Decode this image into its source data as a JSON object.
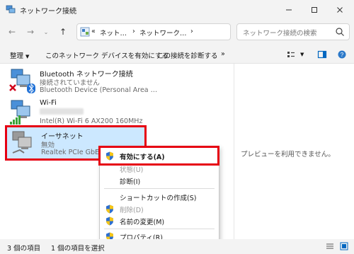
{
  "window": {
    "title": "ネットワーク接続"
  },
  "address": {
    "segments": [
      "«",
      "ネット…",
      "›",
      "ネットワーク…",
      "›"
    ]
  },
  "search": {
    "placeholder": "ネットワーク接続の検索"
  },
  "command_bar": {
    "organize": "整理",
    "enable_device": "このネットワーク デバイスを有効にする",
    "diagnose": "この接続を診断する",
    "more": "»"
  },
  "connections": [
    {
      "name": "Bluetooth ネットワーク接続",
      "status": "接続されていません",
      "device": "Bluetooth Device (Personal Area …"
    },
    {
      "name": "Wi-Fi",
      "status": "",
      "device": "Intel(R) Wi-Fi 6 AX200 160MHz"
    },
    {
      "name": "イーサネット",
      "status": "無効",
      "device": "Realtek PCIe GbE Fan"
    }
  ],
  "preview": {
    "text": "プレビューを利用できません。"
  },
  "context_menu": {
    "enable": "有効にする(A)",
    "status": "状態(U)",
    "diagnose": "診断(I)",
    "create_shortcut": "ショートカットの作成(S)",
    "delete": "削除(D)",
    "rename": "名前の変更(M)",
    "properties": "プロパティ(R)"
  },
  "status_bar": {
    "count": "3 個の項目",
    "selected": "1 個の項目を選択"
  },
  "colors": {
    "highlight": "#e60012",
    "selection": "#cce8ff",
    "accent": "#0067c0"
  }
}
